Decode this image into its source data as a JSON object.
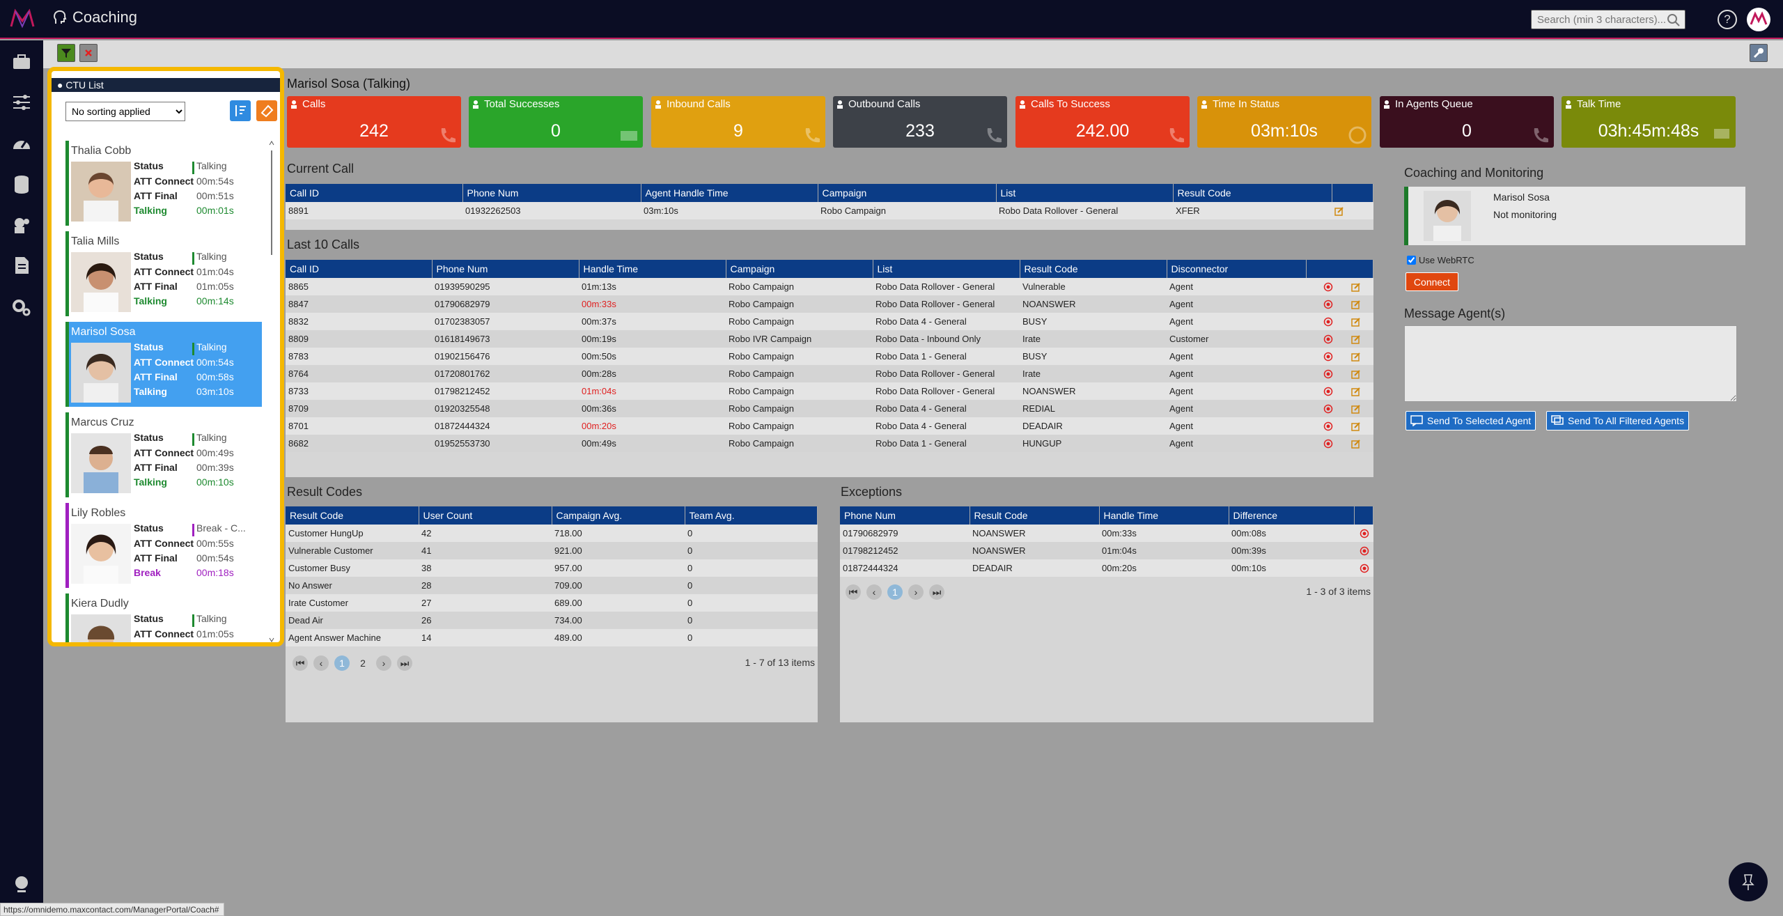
{
  "app": {
    "title": "Coaching"
  },
  "search": {
    "placeholder": "Search (min 3 characters)..."
  },
  "help_label": "?",
  "ctu": {
    "title": "CTU List",
    "sort_value": "No sorting applied",
    "agents": [
      {
        "name": "Thalia Cobb",
        "status": "Talking",
        "att_connect": "00m:54s",
        "att_final": "00m:51s",
        "state": "Talking",
        "state_time": "00m:01s",
        "color": "#1e8a30"
      },
      {
        "name": "Talia Mills",
        "status": "Talking",
        "att_connect": "01m:04s",
        "att_final": "01m:05s",
        "state": "Talking",
        "state_time": "00m:14s",
        "color": "#1e8a30"
      },
      {
        "name": "Marisol Sosa",
        "status": "Talking",
        "att_connect": "00m:54s",
        "att_final": "00m:58s",
        "state": "Talking",
        "state_time": "03m:10s",
        "color": "#1e8a30"
      },
      {
        "name": "Marcus Cruz",
        "status": "Talking",
        "att_connect": "00m:49s",
        "att_final": "00m:39s",
        "state": "Talking",
        "state_time": "00m:10s",
        "color": "#1e8a30"
      },
      {
        "name": "Lily Robles",
        "status": "Break - C...",
        "att_connect": "00m:55s",
        "att_final": "00m:54s",
        "state": "Break",
        "state_time": "00m:18s",
        "color": "#a020c0"
      },
      {
        "name": "Kiera Dudly",
        "status": "Talking",
        "att_connect": "01m:05s",
        "att_final": "",
        "state": "",
        "state_time": "",
        "color": "#1e8a30"
      }
    ],
    "labels": {
      "status": "Status",
      "att_connect": "ATT Connect",
      "att_final": "ATT Final"
    }
  },
  "agent_heading": "Marisol Sosa (Talking)",
  "kpis": [
    {
      "title": "Calls",
      "value": "242",
      "color": "#e53a1e"
    },
    {
      "title": "Total Successes",
      "value": "0",
      "color": "#2aa52a"
    },
    {
      "title": "Inbound Calls",
      "value": "9",
      "color": "#e0a010"
    },
    {
      "title": "Outbound Calls",
      "value": "233",
      "color": "#3d4148"
    },
    {
      "title": "Calls To Success",
      "value": "242.00",
      "color": "#e53a1e"
    },
    {
      "title": "Time In Status",
      "value": "03m:10s",
      "color": "#d8920a"
    },
    {
      "title": "In Agents Queue",
      "value": "0",
      "color": "#3a0f1e"
    },
    {
      "title": "Talk Time",
      "value": "03h:45m:48s",
      "color": "#7a8a0a"
    }
  ],
  "current_call": {
    "title": "Current Call",
    "headers": [
      "Call ID",
      "Phone Num",
      "Agent Handle Time",
      "Campaign",
      "List",
      "Result Code"
    ],
    "row": [
      "8891",
      "01932262503",
      "03m:10s",
      "Robo Campaign",
      "Robo Data Rollover - General",
      "XFER"
    ]
  },
  "last10": {
    "title": "Last 10 Calls",
    "headers": [
      "Call ID",
      "Phone Num",
      "Handle Time",
      "Campaign",
      "List",
      "Result Code",
      "Disconnector"
    ],
    "rows": [
      [
        "8865",
        "01939590295",
        "01m:13s",
        "Robo Campaign",
        "Robo Data Rollover - General",
        "Vulnerable",
        "Agent"
      ],
      [
        "8847",
        "01790682979",
        "00m:33s",
        "Robo Campaign",
        "Robo Data Rollover - General",
        "NOANSWER",
        "Agent"
      ],
      [
        "8832",
        "01702383057",
        "00m:37s",
        "Robo Campaign",
        "Robo Data 4 - General",
        "BUSY",
        "Agent"
      ],
      [
        "8809",
        "01618149673",
        "00m:19s",
        "Robo IVR Campaign",
        "Robo Data - Inbound Only",
        "Irate",
        "Customer"
      ],
      [
        "8783",
        "01902156476",
        "00m:50s",
        "Robo Campaign",
        "Robo Data 1 - General",
        "BUSY",
        "Agent"
      ],
      [
        "8764",
        "01720801762",
        "00m:28s",
        "Robo Campaign",
        "Robo Data Rollover - General",
        "Irate",
        "Agent"
      ],
      [
        "8733",
        "01798212452",
        "01m:04s",
        "Robo Campaign",
        "Robo Data Rollover - General",
        "NOANSWER",
        "Agent"
      ],
      [
        "8709",
        "01920325548",
        "00m:36s",
        "Robo Campaign",
        "Robo Data 4 - General",
        "REDIAL",
        "Agent"
      ],
      [
        "8701",
        "01872444324",
        "00m:20s",
        "Robo Campaign",
        "Robo Data 4 - General",
        "DEADAIR",
        "Agent"
      ],
      [
        "8682",
        "01952553730",
        "00m:49s",
        "Robo Campaign",
        "Robo Data 1 - General",
        "HUNGUP",
        "Agent"
      ]
    ],
    "red_rows": [
      1,
      6,
      8
    ]
  },
  "result_codes": {
    "title": "Result Codes",
    "headers": [
      "Result Code",
      "User Count",
      "Campaign Avg.",
      "Team Avg."
    ],
    "rows": [
      [
        "Customer HungUp",
        "42",
        "718.00",
        "0"
      ],
      [
        "Vulnerable Customer",
        "41",
        "921.00",
        "0"
      ],
      [
        "Customer Busy",
        "38",
        "957.00",
        "0"
      ],
      [
        "No Answer",
        "28",
        "709.00",
        "0"
      ],
      [
        "Irate Customer",
        "27",
        "689.00",
        "0"
      ],
      [
        "Dead Air",
        "26",
        "734.00",
        "0"
      ],
      [
        "Agent Answer Machine",
        "14",
        "489.00",
        "0"
      ]
    ],
    "pages": [
      "1",
      "2"
    ],
    "items_text": "1 - 7 of 13 items"
  },
  "exceptions": {
    "title": "Exceptions",
    "headers": [
      "Phone Num",
      "Result Code",
      "Handle Time",
      "Difference"
    ],
    "rows": [
      [
        "01790682979",
        "NOANSWER",
        "00m:33s",
        "00m:08s"
      ],
      [
        "01798212452",
        "NOANSWER",
        "01m:04s",
        "00m:39s"
      ],
      [
        "01872444324",
        "DEADAIR",
        "00m:20s",
        "00m:10s"
      ]
    ],
    "pages": [
      "1"
    ],
    "items_text": "1 - 3 of 3 items"
  },
  "coaching": {
    "title": "Coaching and Monitoring",
    "agent_name": "Marisol Sosa",
    "monitor_status": "Not monitoring",
    "webrtc_label": "Use WebRTC",
    "connect_label": "Connect"
  },
  "message": {
    "title": "Message Agent(s)",
    "send_selected": "Send To Selected Agent",
    "send_all": "Send To All Filtered Agents"
  },
  "status_url": "https://omnidemo.maxcontact.com/ManagerPortal/Coach#"
}
